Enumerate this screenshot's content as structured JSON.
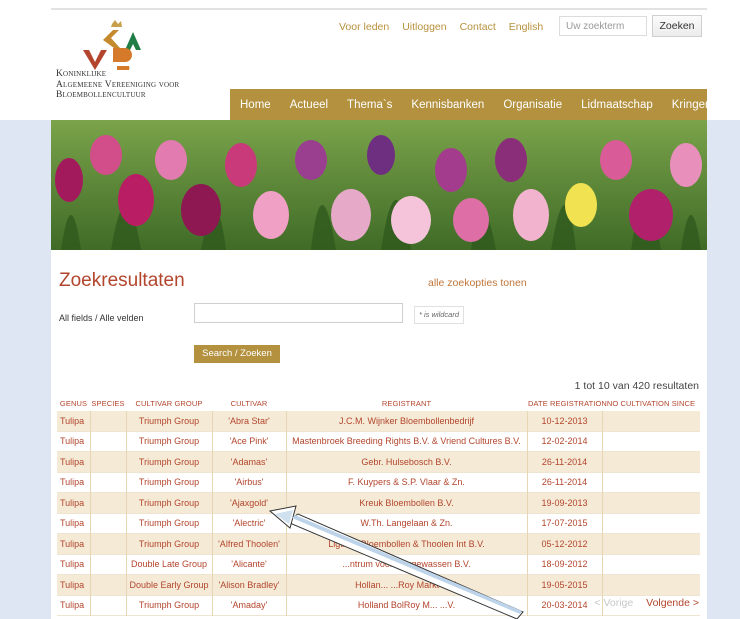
{
  "logo": {
    "lines": [
      "Koninklijke",
      "Algemeene Vereeniging voor",
      "Bloembollencultuur"
    ]
  },
  "util_links": [
    "Voor leden",
    "Uitloggen",
    "Contact",
    "English"
  ],
  "search": {
    "placeholder": "Uw zoekterm",
    "button": "Zoeken"
  },
  "nav": [
    "Home",
    "Actueel",
    "Thema`s",
    "Kennisbanken",
    "Organisatie",
    "Lidmaatschap",
    "Kringen"
  ],
  "page": {
    "title": "Zoekresultaten",
    "all_options": "alle zoekopties tonen",
    "field_label": "All fields / Alle velden",
    "wildcard_note": "* is wildcard",
    "search_button": "Search / Zoeken",
    "result_count": "1 tot 10 van 420 resultaten"
  },
  "table": {
    "headers": [
      "GENUS",
      "SPECIES",
      "CULTIVAR GROUP",
      "CULTIVAR",
      "REGISTRANT",
      "DATE REGISTRATION",
      "NO CULTIVATION SINCE"
    ],
    "rows": [
      [
        "Tulipa",
        "",
        "Triumph Group",
        "'Abra Star'",
        "J.C.M. Wijnker Bloembollenbedrijf",
        "10-12-2013",
        ""
      ],
      [
        "Tulipa",
        "",
        "Triumph Group",
        "'Ace Pink'",
        "Mastenbroek Breeding Rights B.V. & Vriend Cultures B.V.",
        "12-02-2014",
        ""
      ],
      [
        "Tulipa",
        "",
        "Triumph Group",
        "'Adamas'",
        "Gebr. Hulsebosch B.V.",
        "26-11-2014",
        ""
      ],
      [
        "Tulipa",
        "",
        "Triumph Group",
        "'Airbus'",
        "F. Kuypers & S.P. Vlaar & Zn.",
        "26-11-2014",
        ""
      ],
      [
        "Tulipa",
        "",
        "Triumph Group",
        "'Ajaxgold'",
        "Kreuk Bloembollen B.V.",
        "19-09-2013",
        ""
      ],
      [
        "Tulipa",
        "",
        "Triumph Group",
        "'Alectric'",
        "W.Th. Langelaan & Zn.",
        "17-07-2015",
        ""
      ],
      [
        "Tulipa",
        "",
        "Triumph Group",
        "'Alfred Thoolen'",
        "Ligthart Bloembollen & Thoolen Int B.V.",
        "05-12-2012",
        ""
      ],
      [
        "Tulipa",
        "",
        "Double Late Group",
        "'Alicante'",
        "...ntrum voor Siergewassen B.V.",
        "18-09-2012",
        ""
      ],
      [
        "Tulipa",
        "",
        "Double Early Group",
        "'Alison Bradley'",
        "Hollan... ...Roy Markt B.V.",
        "19-05-2015",
        ""
      ],
      [
        "Tulipa",
        "",
        "Triumph Group",
        "'Amaday'",
        "Holland BolRoy M... ...V.",
        "20-03-2014",
        ""
      ]
    ]
  },
  "pagination": {
    "prev": "< Vorige",
    "next": "Volgende >"
  },
  "colors": {
    "gold": "#b3913f",
    "accent": "#b3452c",
    "row_alt": "#f5ead6",
    "page_bg": "#dde6f2"
  }
}
